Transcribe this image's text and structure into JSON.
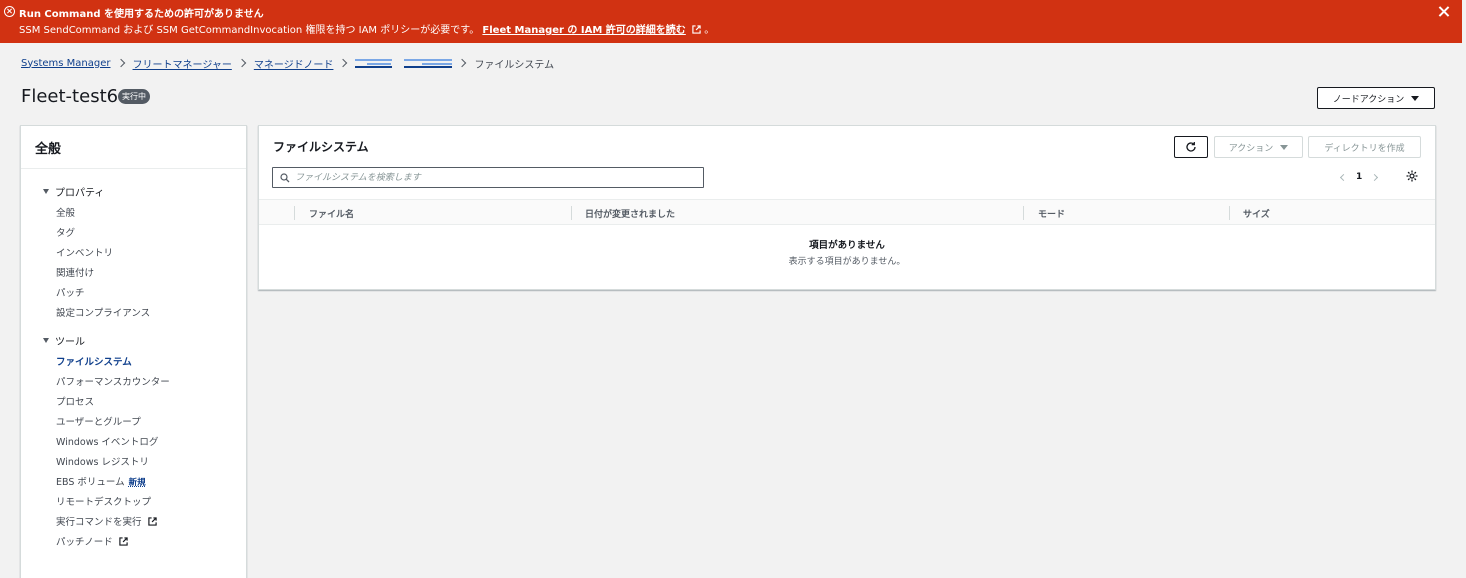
{
  "flash": {
    "title": "Run Command を使用するための許可がありません",
    "message": "SSM SendCommand および SSM GetCommandInvocation 権限を持つ IAM ポリシーが必要です。",
    "link": "Fleet Manager の IAM 許可の詳細を読む"
  },
  "breadcrumb": {
    "items": [
      "Systems Manager",
      "フリートマネージャー",
      "マネージドノード"
    ],
    "current": "ファイルシステム"
  },
  "page": {
    "title": "Fleet-test6",
    "status": "実行中",
    "node_action": "ノードアクション"
  },
  "left_panel": {
    "title": "全般",
    "sections": [
      {
        "label": "プロパティ",
        "items": [
          "全般",
          "タグ",
          "インベントリ",
          "関連付け",
          "パッチ",
          "設定コンプライアンス"
        ]
      },
      {
        "label": "ツール",
        "items": [
          "ファイルシステム",
          "パフォーマンスカウンター",
          "プロセス",
          "ユーザーとグループ",
          "Windows イベントログ",
          "Windows レジストリ",
          "EBS ボリューム",
          "リモートデスクトップ",
          "実行コマンドを実行",
          "パッチノード"
        ]
      }
    ],
    "new_badge": "新規"
  },
  "main": {
    "title": "ファイルシステム",
    "actions_label": "アクション",
    "create_dir_label": "ディレクトリを作成",
    "search_placeholder": "ファイルシステムを検索します",
    "page_number": "1",
    "columns": [
      "ファイル名",
      "日付が変更されました",
      "モード",
      "サイズ"
    ],
    "empty_title": "項目がありません",
    "empty_message": "表示する項目がありません。"
  },
  "colors": {
    "flash_bg": "#d13212",
    "link": "#0f3f8c",
    "badge_bg": "#545b64"
  }
}
